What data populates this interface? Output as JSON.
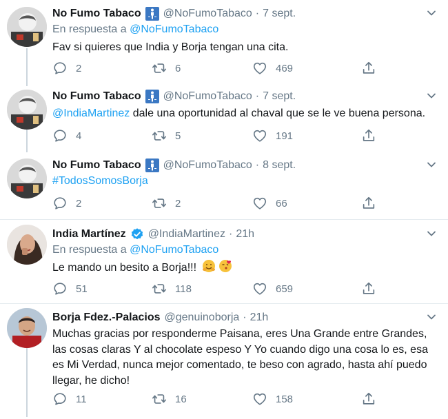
{
  "tweets": [
    {
      "name": "No Fumo Tabaco",
      "handle": "@NoFumoTabaco",
      "dot": "·",
      "time": "7 sept.",
      "reply_prefix": "En respuesta a",
      "reply_to": "@NoFumoTabaco",
      "text": "Fav si quieres que India y Borja tengan una cita.",
      "replies": "2",
      "retweets": "6",
      "likes": "469"
    },
    {
      "name": "No Fumo Tabaco",
      "handle": "@NoFumoTabaco",
      "dot": "·",
      "time": "7 sept.",
      "mention": "@IndiaMartinez",
      "text": " dale una oportunidad al chaval que se le ve buena persona.",
      "replies": "4",
      "retweets": "5",
      "likes": "191"
    },
    {
      "name": "No Fumo Tabaco",
      "handle": "@NoFumoTabaco",
      "dot": "·",
      "time": "8 sept.",
      "hashtag": "#TodosSomosBorja",
      "replies": "2",
      "retweets": "2",
      "likes": "66"
    },
    {
      "name": "India Martínez",
      "handle": "@IndiaMartinez",
      "dot": "·",
      "time": "21h",
      "reply_prefix": "En respuesta a",
      "reply_to": "@NoFumoTabaco",
      "text": "Le mando un besito a Borja!!!",
      "replies": "51",
      "retweets": "118",
      "likes": "659"
    },
    {
      "name": "Borja Fdez.-Palacios",
      "handle": "@genuinoborja",
      "dot": "·",
      "time": "21h",
      "text": "Muchas gracias por responderme Paisana, eres Una Grande entre Grandes, las cosas claras Y al chocolate espeso Y Yo cuando digo una cosa lo es, esa es Mi Verdad, nunca mejor comentado, te beso con agrado, hasta ahí puedo llegar, he dicho!",
      "replies": "11",
      "retweets": "16",
      "likes": "158"
    }
  ],
  "colors": {
    "link": "#1da1f2",
    "muted": "#657786",
    "text": "#14171a",
    "verified": "#1da1f2",
    "thread_line": "#ccd6dd"
  },
  "icons": [
    "reply-icon",
    "retweet-icon",
    "like-icon",
    "share-icon",
    "chevron-down-icon",
    "no-smoking-badge-icon",
    "verified-badge-icon",
    "hug-emoji",
    "kiss-emoji"
  ]
}
